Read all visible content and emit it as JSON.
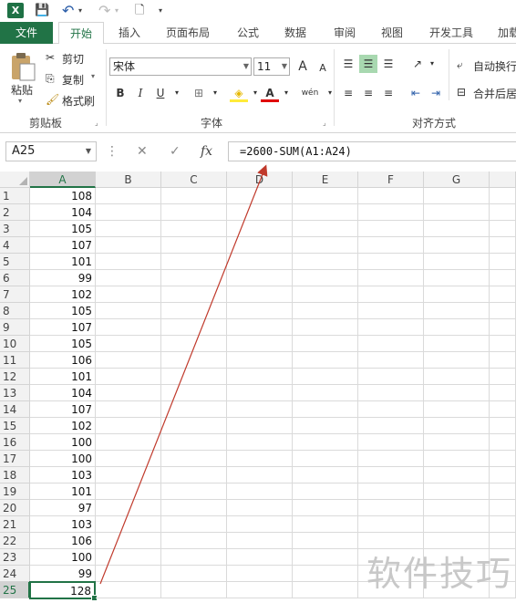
{
  "qat": {
    "logo": "X",
    "save": "💾",
    "undo": "↶",
    "redo": "↷",
    "new": "🗋",
    "more": "▾"
  },
  "tabs": [
    "文件",
    "开始",
    "插入",
    "页面布局",
    "公式",
    "数据",
    "审阅",
    "视图",
    "开发工具",
    "加载"
  ],
  "active_tab_index": 1,
  "ribbon": {
    "clipboard": {
      "paste": "粘贴",
      "cut": "剪切",
      "copy": "复制",
      "format_painter": "格式刷",
      "label": "剪贴板"
    },
    "font": {
      "name": "宋体",
      "size": "11",
      "grow": "A",
      "shrink": "A",
      "bold": "B",
      "italic": "I",
      "underline": "U",
      "border": "⊞",
      "fill": "◈",
      "color": "A",
      "phonetic": "wén",
      "label": "字体"
    },
    "alignment": {
      "wrap_text": "自动换行",
      "merge_center": "合并后居",
      "label": "对齐方式"
    }
  },
  "formula_bar": {
    "name_box": "A25",
    "more_icon": "⋮",
    "cancel_icon": "✕",
    "enter_icon": "✓",
    "fx_icon": "fx",
    "formula": "=2600-SUM(A1:A24)"
  },
  "columns": [
    "A",
    "B",
    "C",
    "D",
    "E",
    "F",
    "G"
  ],
  "rows": [
    "1",
    "2",
    "3",
    "4",
    "5",
    "6",
    "7",
    "8",
    "9",
    "10",
    "11",
    "12",
    "13",
    "14",
    "15",
    "16",
    "17",
    "18",
    "19",
    "20",
    "21",
    "22",
    "23",
    "24",
    "25"
  ],
  "column_a_values": [
    108,
    104,
    105,
    107,
    101,
    99,
    102,
    105,
    107,
    105,
    106,
    101,
    104,
    107,
    102,
    100,
    100,
    103,
    101,
    97,
    103,
    106,
    100,
    99,
    128
  ],
  "active_cell": "A25",
  "watermark": "软件技巧",
  "colors": {
    "excel_green": "#217346",
    "arrow": "#c0392b"
  }
}
